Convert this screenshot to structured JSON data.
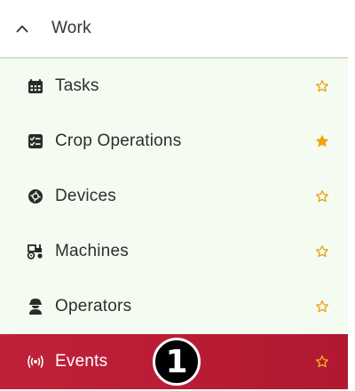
{
  "section": {
    "title": "Work",
    "caret_icon": "chevron-up-icon"
  },
  "colors": {
    "list_background": "#f4fbf1",
    "active_background": "#b81c34",
    "star_outline": "#e8a21a",
    "star_filled": "#f0a30a"
  },
  "items": [
    {
      "label": "Tasks",
      "icon": "calendar-icon",
      "favorite": false
    },
    {
      "label": "Crop Operations",
      "icon": "checklist-icon",
      "favorite": true
    },
    {
      "label": "Devices",
      "icon": "device-icon",
      "favorite": false
    },
    {
      "label": "Machines",
      "icon": "tractor-icon",
      "favorite": false
    },
    {
      "label": "Operators",
      "icon": "operator-icon",
      "favorite": false
    },
    {
      "label": "Events",
      "icon": "broadcast-icon",
      "favorite": false,
      "active": true
    }
  ],
  "annotation": {
    "badge_text": "1"
  }
}
